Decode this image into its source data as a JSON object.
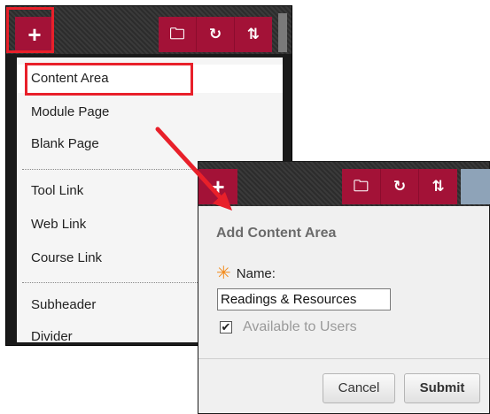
{
  "menu_panel": {
    "add_button_label": "+",
    "toolbar_icons": [
      "folder-icon",
      "refresh-icon",
      "sort-icon"
    ],
    "toolbar_glyphs": {
      "folder": "🗀",
      "refresh": "↻",
      "sort": "⇅"
    },
    "items": [
      {
        "label": "Content Area"
      },
      {
        "label": "Module Page"
      },
      {
        "label": "Blank Page"
      },
      {
        "label": "Tool Link"
      },
      {
        "label": "Web Link"
      },
      {
        "label": "Course Link"
      },
      {
        "label": "Subheader"
      },
      {
        "label": "Divider"
      }
    ]
  },
  "dialog": {
    "add_button_label": "+",
    "title": "Add Content Area",
    "name_label": "Name:",
    "required_mark": "✳",
    "name_value": "Readings & Resources",
    "available_checked": true,
    "checkbox_mark": "✔",
    "available_label": "Available to Users",
    "cancel_label": "Cancel",
    "submit_label": "Submit"
  },
  "colors": {
    "accent": "#a31237",
    "highlight": "#e8202a",
    "required": "#f28a1a"
  }
}
